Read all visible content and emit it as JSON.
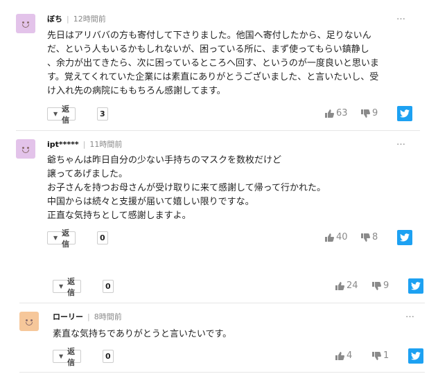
{
  "comments": [
    {
      "user": "ぼち",
      "time": "12時間前",
      "lines": [
        "先日はアリババの方も寄付して下さりました。他国へ寄付したから、足りないん",
        "だ、という人もいるかもしれないが、困っている所に、まず使ってもらい鎮静し",
        "、余力が出てきたら、次に困っているところへ回す、というのが一度良いと思いま",
        "す。覚えてくれていた企業には素直にありがとうございました、と言いたいし、受",
        "け入れ先の病院にももちろん感謝してます。"
      ],
      "reply_label": "返信",
      "reply_count": "3",
      "likes": "63",
      "dislikes": "9",
      "more": "…",
      "avatar_color": "#e3c3ea"
    },
    {
      "user": "ipt*****",
      "time": "11時間前",
      "lines": [
        "爺ちゃんは昨日自分の少ない手持ちのマスクを数枚だけど",
        "譲ってあげました。",
        "お子さんを持つお母さんが受け取りに来て感謝して帰って行かれた。",
        "中国からは続々と支援が届いて嬉しい限りですな。",
        "正直な気持ちとして感謝しますよ。"
      ],
      "reply_label": "返信",
      "reply_count": "0",
      "likes": "40",
      "dislikes": "8",
      "more": "…",
      "avatar_color": "#e3c3ea"
    },
    {
      "reply_label": "返信",
      "reply_count": "0",
      "likes": "24",
      "dislikes": "9"
    },
    {
      "user": "ローリー",
      "time": "8時間前",
      "lines": [
        "素直な気持ちでありがとうと言いたいです。"
      ],
      "reply_label": "返信",
      "reply_count": "0",
      "likes": "4",
      "dislikes": "1",
      "more": "…",
      "avatar_color": "#f6c79a"
    }
  ],
  "colors": {
    "twitter": "#1da1f2"
  },
  "icons": {
    "like": "thumbs-up-icon",
    "dislike": "thumbs-down-icon",
    "share": "twitter-icon",
    "avatar": "smiley-face-icon"
  }
}
